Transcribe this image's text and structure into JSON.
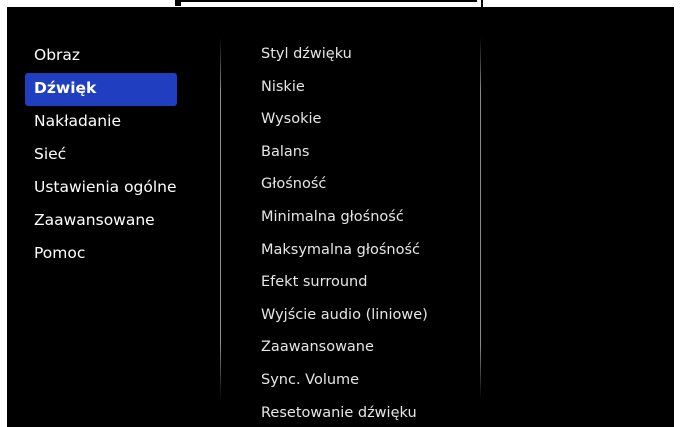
{
  "menu": {
    "items": [
      {
        "label": "Obraz"
      },
      {
        "label": "Dźwięk",
        "active": true
      },
      {
        "label": "Nakładanie"
      },
      {
        "label": "Sieć"
      },
      {
        "label": "Ustawienia ogólne"
      },
      {
        "label": "Zaawansowane"
      },
      {
        "label": "Pomoc"
      }
    ]
  },
  "submenu": {
    "items": [
      {
        "label": "Styl dźwięku"
      },
      {
        "label": "Niskie"
      },
      {
        "label": "Wysokie"
      },
      {
        "label": "Balans"
      },
      {
        "label": "Głośność"
      },
      {
        "label": "Minimalna głośność"
      },
      {
        "label": "Maksymalna głośność"
      },
      {
        "label": "Efekt surround"
      },
      {
        "label": "Wyjście audio (liniowe)"
      },
      {
        "label": "Zaawansowane"
      },
      {
        "label": "Sync. Volume"
      },
      {
        "label": "Resetowanie dźwięku"
      }
    ]
  },
  "colors": {
    "background": "#000000",
    "selection": "#1f3fc0",
    "text": "#ffffff"
  }
}
